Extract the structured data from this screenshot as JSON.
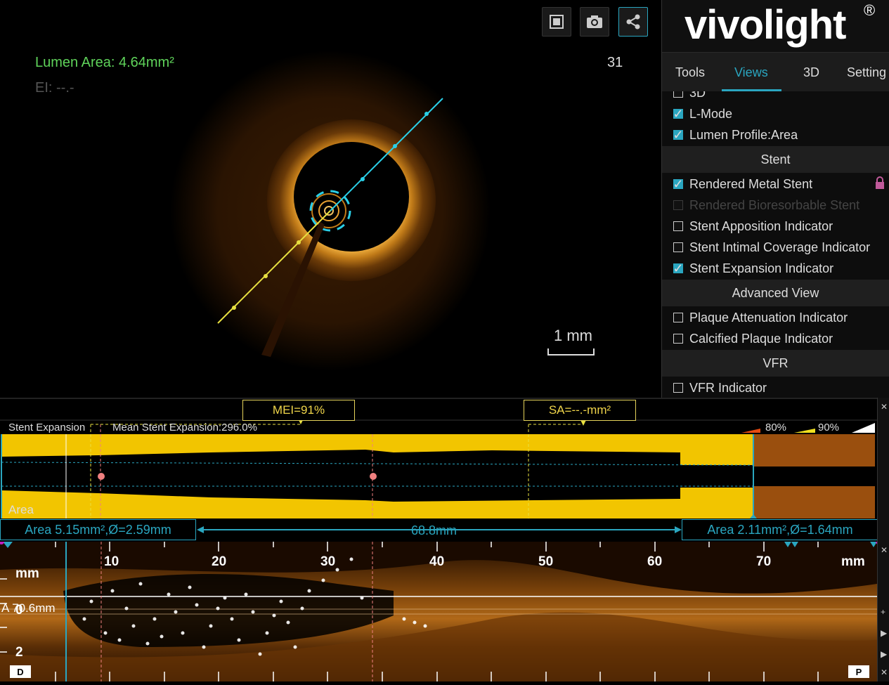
{
  "viewer": {
    "lumen_area": "Lumen Area: 4.64mm²",
    "ei": "EI: --.-",
    "frame": "31",
    "scale": "1 mm",
    "buttons": [
      "fullscreen-icon",
      "camera-icon",
      "share-icon"
    ]
  },
  "brand": {
    "name": "vivolight",
    "reg": "®"
  },
  "tabs": [
    {
      "label": "Tools"
    },
    {
      "label": "Views"
    },
    {
      "label": "3D"
    },
    {
      "label": "Setting"
    }
  ],
  "options": [
    {
      "label": "3D",
      "checked": false
    },
    {
      "label": "L-Mode",
      "checked": true
    },
    {
      "label": "Lumen Profile:Area",
      "checked": true
    }
  ],
  "sections": {
    "stent": "Stent",
    "advanced": "Advanced View",
    "vfr": "VFR"
  },
  "stent_options": [
    {
      "label": "Rendered Metal Stent",
      "checked": true
    },
    {
      "label": "Rendered Bioresorbable Stent",
      "checked": false,
      "disabled": true
    },
    {
      "label": "Stent Apposition Indicator",
      "checked": false
    },
    {
      "label": "Stent Intimal Coverage Indicator",
      "checked": false
    },
    {
      "label": "Stent Expansion Indicator",
      "checked": true
    }
  ],
  "advanced_options": [
    {
      "label": "Plaque Attenuation Indicator",
      "checked": false
    },
    {
      "label": "Calcified Plaque Indicator",
      "checked": false
    }
  ],
  "vfr_options": [
    {
      "label": "VFR Indicator",
      "checked": false
    }
  ],
  "profile": {
    "mei": "MEI=91%",
    "sa": "SA=--.-mm²",
    "stent_expansion": "Stent Expansion",
    "mean_stent_expansion": "Mean Stent Expansion:296.0%",
    "pct80": "80%",
    "pct90": "90%",
    "area": "Area",
    "left_measure": "Area 5.15mm²,Ø=2.59mm",
    "length": "68.8mm",
    "right_measure": "Area 2.11mm²,Ø=1.64mm",
    "colors": {
      "fill": "#f2c500",
      "brown": "#9a4f0e",
      "accent": "#2aa6c0"
    }
  },
  "lmode": {
    "ticks": [
      "10",
      "20",
      "30",
      "40",
      "50",
      "60",
      "70"
    ],
    "unit_left": "mm",
    "unit_right": "mm",
    "side0": "0",
    "side2": "2",
    "measure": "A 70.6mm",
    "distal": "D",
    "proximal": "P"
  }
}
